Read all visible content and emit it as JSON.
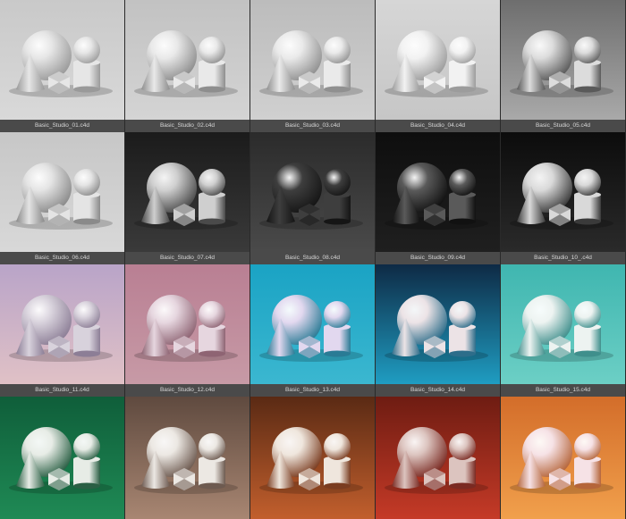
{
  "tiles": [
    {
      "label": "Basic_Studio_01.c4d",
      "bgTop": "#c9c9c9",
      "bgBottom": "#d9d9d9",
      "obj": "#e6e6e6",
      "shade": "#9a9a9a"
    },
    {
      "label": "Basic_Studio_02.c4d",
      "bgTop": "#c2c2c2",
      "bgBottom": "#d4d4d4",
      "obj": "#e9e9e9",
      "shade": "#8e8e8e"
    },
    {
      "label": "Basic_Studio_03.c4d",
      "bgTop": "#bcbcbc",
      "bgBottom": "#d0d0d0",
      "obj": "#eaeaea",
      "shade": "#909090"
    },
    {
      "label": "Basic_Studio_04.c4d",
      "bgTop": "#d6d6d6",
      "bgBottom": "#c6c6c6",
      "obj": "#f2f2f2",
      "shade": "#9c9c9c"
    },
    {
      "label": "Basic_Studio_05.c4d",
      "bgTop": "#6e6e6e",
      "bgBottom": "#a9a9a9",
      "obj": "#dcdcdc",
      "shade": "#5a5a5a"
    },
    {
      "label": "Basic_Studio_06.c4d",
      "bgTop": "#c7c7c7",
      "bgBottom": "#d8d8d8",
      "obj": "#e4e4e4",
      "shade": "#8a8a8a"
    },
    {
      "label": "Basic_Studio_07.c4d",
      "bgTop": "#1b1b1b",
      "bgBottom": "#3a3a3a",
      "obj": "#cfcfcf",
      "shade": "#4a4a4a"
    },
    {
      "label": "Basic_Studio_08.c4d",
      "bgTop": "#2b2b2b",
      "bgBottom": "#4a4a4a",
      "obj": "#3e3e3e",
      "shade": "#151515"
    },
    {
      "label": "Basic_Studio_09.c4d",
      "bgTop": "#0e0e0e",
      "bgBottom": "#1f1f1f",
      "obj": "#5a5a5a",
      "shade": "#111111"
    },
    {
      "label": "Basic_Studio_10_.c4d",
      "bgTop": "#0c0c0c",
      "bgBottom": "#2a2a2a",
      "obj": "#d9d9d9",
      "shade": "#3a3a3a"
    },
    {
      "label": "Basic_Studio_11.c4d",
      "bgTop": "#b9a4c8",
      "bgBottom": "#e0c1c6",
      "obj": "#d8d2dc",
      "shade": "#8c7e96"
    },
    {
      "label": "Basic_Studio_12.c4d",
      "bgTop": "#b97f93",
      "bgBottom": "#c79aa6",
      "obj": "#e6d6df",
      "shade": "#8e6473"
    },
    {
      "label": "Basic_Studio_13.c4d",
      "bgTop": "#1aa3c4",
      "bgBottom": "#3bb7d0",
      "obj": "#e2d8ef",
      "shade": "#2a7b95"
    },
    {
      "label": "Basic_Studio_14.c4d",
      "bgTop": "#0e2a45",
      "bgBottom": "#1f9dc2",
      "obj": "#ece3e6",
      "shade": "#2d6d8a"
    },
    {
      "label": "Basic_Studio_15.c4d",
      "bgTop": "#3fb6b0",
      "bgBottom": "#6ccfc5",
      "obj": "#edf3f1",
      "shade": "#3f8f8c"
    },
    {
      "label": "",
      "bgTop": "#0f5e3a",
      "bgBottom": "#1f8a55",
      "obj": "#e7ece6",
      "shade": "#2a5f44"
    },
    {
      "label": "",
      "bgTop": "#5f4a3f",
      "bgBottom": "#a88672",
      "obj": "#ece8e3",
      "shade": "#6d5a50"
    },
    {
      "label": "",
      "bgTop": "#5a2a14",
      "bgBottom": "#c25f2d",
      "obj": "#efe6dd",
      "shade": "#7a3c20"
    },
    {
      "label": "",
      "bgTop": "#6e1c12",
      "bgBottom": "#c53a27",
      "obj": "#dcc4bf",
      "shade": "#7a2a22"
    },
    {
      "label": "",
      "bgTop": "#d36d2a",
      "bgBottom": "#f1a04c",
      "obj": "#f6e2e6",
      "shade": "#b5653a"
    }
  ]
}
